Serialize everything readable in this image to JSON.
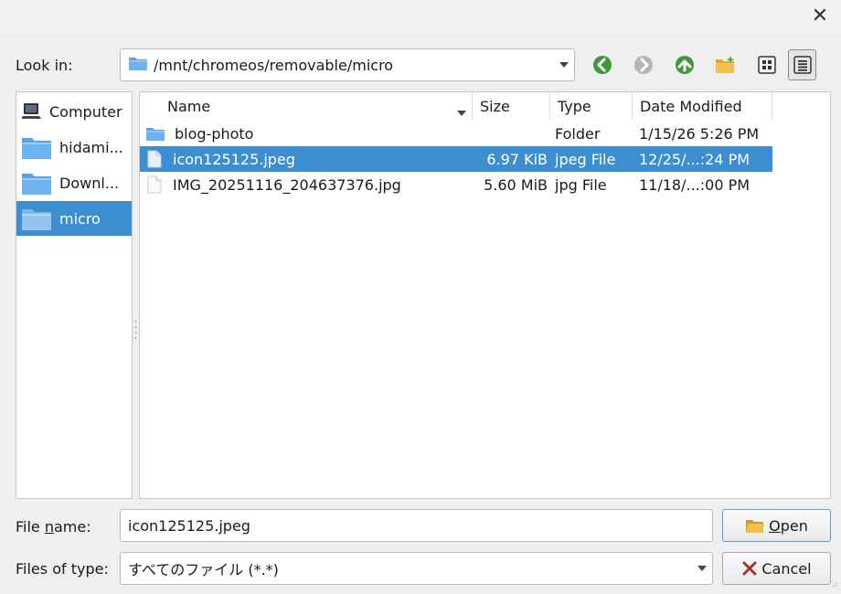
{
  "window": {
    "close_symbol": "✕"
  },
  "lookin": {
    "label": "Look in:",
    "path": "/mnt/chromeos/removable/micro"
  },
  "toolbar": {
    "icons": [
      "back-icon",
      "forward-icon",
      "parent-folder-icon",
      "new-folder-icon",
      "icon-view-icon",
      "detail-view-icon"
    ]
  },
  "sidebar": {
    "items": [
      {
        "label": "Computer",
        "icon": "computer-icon"
      },
      {
        "label": "hidami...",
        "icon": "folder-icon"
      },
      {
        "label": "Downl...",
        "icon": "folder-icon"
      },
      {
        "label": "micro",
        "icon": "folder-icon",
        "selected": true
      }
    ]
  },
  "filelist": {
    "columns": [
      "Name",
      "Size",
      "Type",
      "Date Modified"
    ],
    "rows": [
      {
        "name": "blog-photo",
        "size": "",
        "type": "Folder",
        "date": "1/15/26 5:26 PM",
        "icon": "folder-icon"
      },
      {
        "name": "icon125125.jpeg",
        "size": "6.97 KiB",
        "type": "jpeg File",
        "date": "12/25/...:24 PM",
        "icon": "file-icon",
        "selected": true
      },
      {
        "name": "IMG_20251116_204637376.jpg",
        "size": "5.60 MiB",
        "type": "jpg File",
        "date": "11/18/...:00 PM",
        "icon": "file-icon"
      }
    ]
  },
  "bottom": {
    "filename_label_pre": "File ",
    "filename_label_mnemonic": "n",
    "filename_label_post": "ame:",
    "filename_value": "icon125125.jpeg",
    "filetype_label": "Files of type:",
    "filetype_value": "すべてのファイル (*.*)",
    "open_mnemonic": "O",
    "open_rest": "pen",
    "cancel_label": "Cancel"
  },
  "colors": {
    "selection": "#3d8ed0",
    "folder": "#5aa3e8",
    "nav_green": "#3c9a3c"
  }
}
